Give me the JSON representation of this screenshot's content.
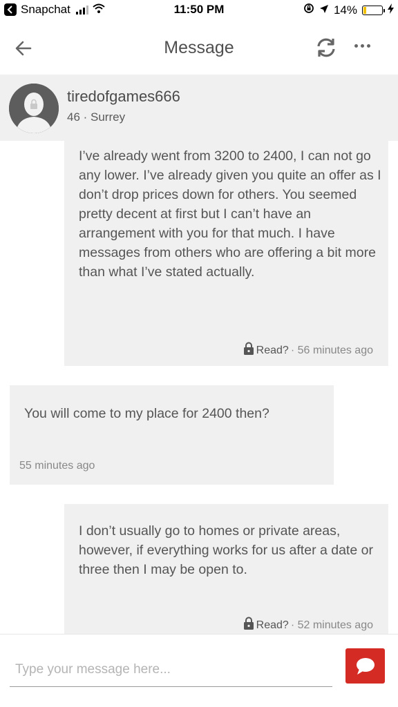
{
  "status_bar": {
    "back_app": "Snapchat",
    "time": "11:50 PM",
    "battery": "14%",
    "battery_level": 0.14
  },
  "nav": {
    "title": "Message",
    "icons": [
      "back-arrow-icon",
      "refresh-icon",
      "more-icon"
    ]
  },
  "profile": {
    "username": "tiredofgames666",
    "subtitle": "46 · Surrey"
  },
  "messages": [
    {
      "direction": "outgoing",
      "text": "I’ve already went from 3200 to 2400, I can not go any lower. I’ve already given you quite an offer as I don’t drop prices down for others. You seemed pretty decent at first but I can’t have an arrangement with you for that much. I have messages from others who are offering a bit more than what I’ve stated actually.",
      "read_label": "Read?",
      "time": "· 56  minutes ago"
    },
    {
      "direction": "incoming",
      "text": "You will come to my place for 2400 then?",
      "time": "55  minutes ago"
    },
    {
      "direction": "outgoing",
      "text": "I don’t usually go to homes or private areas, however, if everything works for us after a date or three then I may be open to.",
      "read_label": "Read?",
      "time": "· 52  minutes ago"
    }
  ],
  "composer": {
    "placeholder": "Type your message here...",
    "send_color": "#d42c24"
  }
}
